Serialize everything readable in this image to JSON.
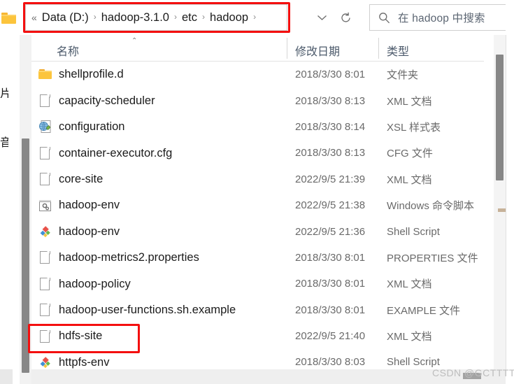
{
  "addressbar": {
    "overflow_indicator": "«",
    "crumbs": [
      "Data (D:)",
      "hadoop-3.1.0",
      "etc",
      "hadoop"
    ],
    "separator": "›",
    "trailing_separator": "›",
    "highlight_color": "#f40f0f"
  },
  "toolbar": {
    "chevron_down_name": "previous-locations",
    "refresh_name": "refresh"
  },
  "search": {
    "placeholder": "在 hadoop 中搜索",
    "icon": "search-icon"
  },
  "columns": {
    "name": "名称",
    "date_modified": "修改日期",
    "type": "类型",
    "sort_caret": "⌃"
  },
  "left_pane": {
    "ghost_text_1": "片",
    "ghost_text_2": "音",
    "ghost_text_3": "）"
  },
  "files": [
    {
      "name": "shellprofile.d",
      "date": "2018/3/30 8:01",
      "type": "文件夹",
      "icon": "folder-icon"
    },
    {
      "name": "capacity-scheduler",
      "date": "2018/3/30 8:13",
      "type": "XML 文档",
      "icon": "document-icon"
    },
    {
      "name": "configuration",
      "date": "2018/3/30 8:14",
      "type": "XSL 样式表",
      "icon": "xsl-stylesheet-icon"
    },
    {
      "name": "container-executor.cfg",
      "date": "2018/3/30 8:13",
      "type": "CFG 文件",
      "icon": "document-icon"
    },
    {
      "name": "core-site",
      "date": "2022/9/5 21:39",
      "type": "XML 文档",
      "icon": "document-icon"
    },
    {
      "name": "hadoop-env",
      "date": "2022/9/5 21:38",
      "type": "Windows 命令脚本",
      "icon": "cmd-script-icon"
    },
    {
      "name": "hadoop-env",
      "date": "2022/9/5 21:36",
      "type": "Shell Script",
      "icon": "shell-script-icon"
    },
    {
      "name": "hadoop-metrics2.properties",
      "date": "2018/3/30 8:01",
      "type": "PROPERTIES 文件",
      "icon": "document-icon"
    },
    {
      "name": "hadoop-policy",
      "date": "2018/3/30 8:01",
      "type": "XML 文档",
      "icon": "document-icon"
    },
    {
      "name": "hadoop-user-functions.sh.example",
      "date": "2018/3/30 8:01",
      "type": "EXAMPLE 文件",
      "icon": "document-icon"
    },
    {
      "name": "hdfs-site",
      "date": "2022/9/5 21:40",
      "type": "XML 文档",
      "icon": "document-icon"
    },
    {
      "name": "httpfs-env",
      "date": "2018/3/30 8:03",
      "type": "Shell Script",
      "icon": "shell-script-icon"
    }
  ],
  "annotations": {
    "highlighted_file": "hdfs-site"
  },
  "watermark": {
    "text": "CSDN @GCTTTTTTT"
  }
}
